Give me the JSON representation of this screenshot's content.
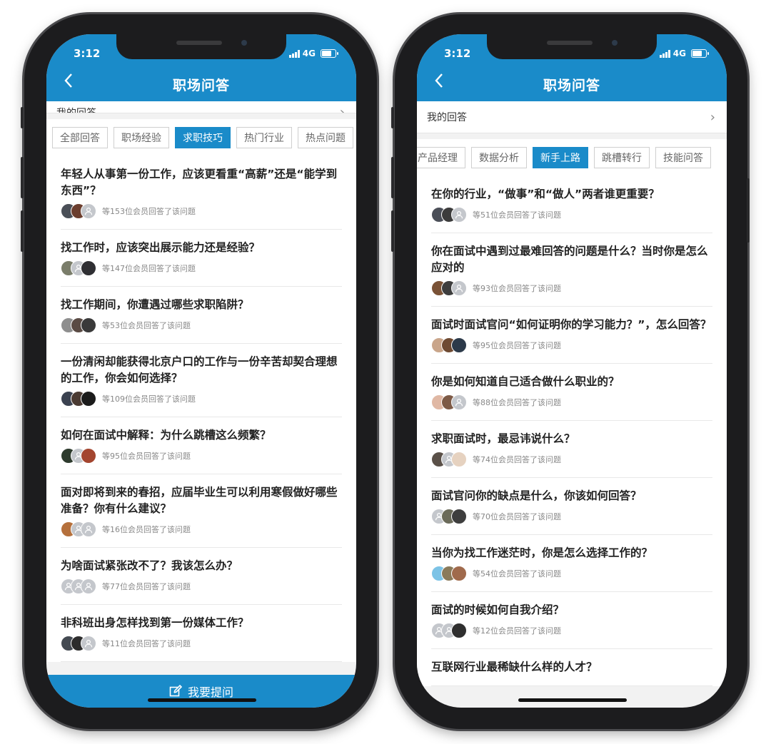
{
  "left": {
    "time": "3:12",
    "network": "4G",
    "title": "职场问答",
    "my_answers": "我的回答",
    "tabs": [
      {
        "label": "全部回答",
        "active": false
      },
      {
        "label": "职场经验",
        "active": false
      },
      {
        "label": "求职技巧",
        "active": true
      },
      {
        "label": "热门行业",
        "active": false
      },
      {
        "label": "热点问题",
        "active": false
      }
    ],
    "questions": [
      {
        "text": "年轻人从事第一份工作，应该更看重“高薪”还是“能学到东西”？",
        "count": "等153位会员回答了该问题",
        "avatars": [
          "#4a4f57",
          "#6b3e2e",
          "user"
        ]
      },
      {
        "text": "找工作时，应该突出展示能力还是经验？",
        "count": "等147位会员回答了该问题",
        "avatars": [
          "#7a7d6a",
          "user",
          "#2f2f33"
        ]
      },
      {
        "text": "找工作期间，你遭遇过哪些求职陷阱？",
        "count": "等53位会员回答了该问题",
        "avatars": [
          "#8e8e8e",
          "#5a4b44",
          "#3a3a3a"
        ]
      },
      {
        "text": "一份清闲却能获得北京户口的工作与一份辛苦却契合理想的工作，你会如何选择？",
        "count": "等109位会员回答了该问题",
        "avatars": [
          "#3b4250",
          "#4a3a32",
          "#1b1b1b"
        ]
      },
      {
        "text": "如何在面试中解释：为什么跳槽这么频繁？",
        "count": "等95位会员回答了该问题",
        "avatars": [
          "#2e3b2e",
          "user",
          "#a3452f"
        ]
      },
      {
        "text": "面对即将到来的春招，应届毕业生可以利用寒假做好哪些准备？你有什么建议？",
        "count": "等16位会员回答了该问题",
        "avatars": [
          "#b5703c",
          "user",
          "user"
        ]
      },
      {
        "text": "为啥面试紧张改不了？我该怎么办？",
        "count": "等77位会员回答了该问题",
        "avatars": [
          "user",
          "user",
          "user"
        ]
      },
      {
        "text": "非科班出身怎样找到第一份媒体工作？",
        "count": "等11位会员回答了该问题",
        "avatars": [
          "#444a52",
          "#2c2c2c",
          "user"
        ]
      }
    ],
    "ask_button": "我要提问"
  },
  "right": {
    "time": "3:12",
    "network": "4G",
    "title": "职场问答",
    "my_answers": "我的回答",
    "tabs": [
      {
        "label": "产品经理",
        "active": false
      },
      {
        "label": "数据分析",
        "active": false
      },
      {
        "label": "新手上路",
        "active": true
      },
      {
        "label": "跳槽转行",
        "active": false
      },
      {
        "label": "技能问答",
        "active": false
      }
    ],
    "questions": [
      {
        "text": "在你的行业，“做事”和“做人”两者谁更重要？",
        "count": "等51位会员回答了该问题",
        "avatars": [
          "#4b4f58",
          "#3c3c3c",
          "user"
        ]
      },
      {
        "text": "你在面试中遇到过最难回答的问题是什么？当时你是怎么应对的",
        "count": "等93位会员回答了该问题",
        "avatars": [
          "#7a5236",
          "#3d3d3d",
          "user"
        ]
      },
      {
        "text": "面试时面试官问“如何证明你的学习能力？”，怎么回答？",
        "count": "等95位会员回答了该问题",
        "avatars": [
          "#c9a58a",
          "#6e4a32",
          "#2c3a4a"
        ]
      },
      {
        "text": "你是如何知道自己适合做什么职业的？",
        "count": "等88位会员回答了该问题",
        "avatars": [
          "#e0b8a4",
          "#7d5a46",
          "user"
        ]
      },
      {
        "text": "求职面试时，最忌讳说什么？",
        "count": "等74位会员回答了该问题",
        "avatars": [
          "#5a5048",
          "user",
          "#e6d2c0"
        ]
      },
      {
        "text": "面试官问你的缺点是什么，你该如何回答？",
        "count": "等70位会员回答了该问题",
        "avatars": [
          "user",
          "#6b6b5a",
          "#3e3e3e"
        ]
      },
      {
        "text": "当你为找工作迷茫时，你是怎么选择工作的？",
        "count": "等54位会员回答了该问题",
        "avatars": [
          "#7cc3e6",
          "#8a7a5a",
          "#a06a4c"
        ]
      },
      {
        "text": "面试的时候如何自我介绍？",
        "count": "等12位会员回答了该问题",
        "avatars": [
          "user",
          "user",
          "#2f2f2f"
        ]
      },
      {
        "text": "互联网行业最稀缺什么样的人才？",
        "count": "",
        "avatars": []
      }
    ]
  }
}
